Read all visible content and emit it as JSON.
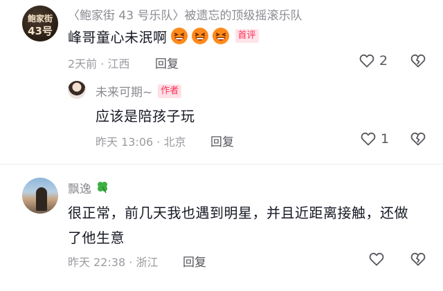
{
  "comment1": {
    "avatar_text": [
      "鲍家街",
      "43号"
    ],
    "name": "〈鲍家街 43 号乐队〉被遗忘的顶级摇滚乐队",
    "text": "峰哥童心未泯啊",
    "emoji_icons": [
      "grinning-squint-face-icon",
      "grinning-squint-face-icon",
      "grinning-squint-face-icon"
    ],
    "badge": "首评",
    "time_location": "2天前 · 江西",
    "reply_label": "回复",
    "like_count": "2"
  },
  "reply1": {
    "name": "未来可期~",
    "author_badge": "作者",
    "text": "应该是陪孩子玩",
    "time_location": "昨天 13:06 · 北京",
    "reply_label": "回复",
    "like_count": "1"
  },
  "comment2": {
    "name": "飘逸",
    "name_icon": "four-leaf-clover-icon",
    "text_line1": "很正常，前几天我也遇到明星，并且近距离接触，还做",
    "text_line2": "了他生意",
    "time_location": "昨天 22:38 · 浙江",
    "reply_label": "回复"
  },
  "colors": {
    "accent_red": "#fe2c55",
    "muted": "#9a9ba0"
  }
}
